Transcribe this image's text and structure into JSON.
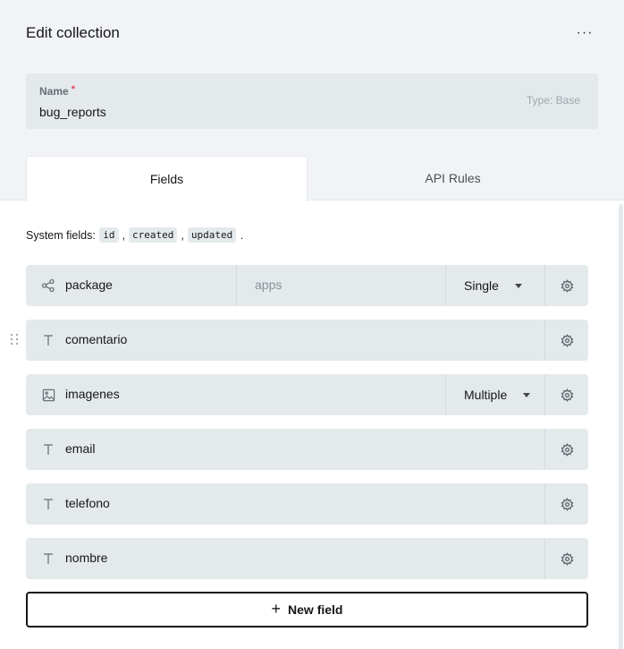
{
  "header": {
    "title": "Edit collection",
    "more_label": "···"
  },
  "name_field": {
    "label": "Name",
    "required_mark": "*",
    "value": "bug_reports",
    "type_label": "Type: Base"
  },
  "tabs": [
    {
      "label": "Fields",
      "active": true
    },
    {
      "label": "API Rules",
      "active": false
    }
  ],
  "system_fields": {
    "prefix": "System fields:",
    "items": [
      "id",
      "created",
      "updated"
    ],
    "suffix": "."
  },
  "fields": [
    {
      "name": "package",
      "icon": "relation-icon",
      "collection": "apps",
      "select": "Single"
    },
    {
      "name": "comentario",
      "icon": "text-icon"
    },
    {
      "name": "imagenes",
      "icon": "image-icon",
      "select": "Multiple"
    },
    {
      "name": "email",
      "icon": "text-icon"
    },
    {
      "name": "telefono",
      "icon": "text-icon"
    },
    {
      "name": "nombre",
      "icon": "text-icon"
    }
  ],
  "new_field_button": {
    "icon": "plus-icon",
    "label": "New field"
  }
}
